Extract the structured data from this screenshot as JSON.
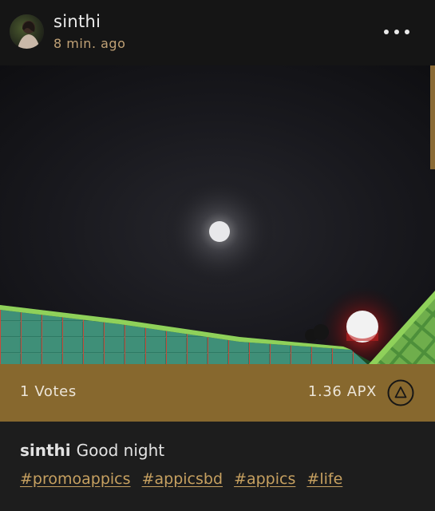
{
  "post": {
    "author": "sinthi",
    "time_ago": "8 min. ago"
  },
  "actions": {
    "more_icon": "more-horizontal-icon",
    "upvote_icon": "triangle-up-icon"
  },
  "votes": {
    "label": "1 Votes",
    "apx": "1.36 APX"
  },
  "caption": {
    "user": "sinthi",
    "text": "Good night"
  },
  "hashtags": [
    "#promoappics",
    "#appicsbd",
    "#appics",
    "#life"
  ],
  "colors": {
    "header_bg": "#151515",
    "accent_gold": "#c1a276",
    "vote_bar": "#87682e",
    "hashtag": "#c6a060"
  }
}
